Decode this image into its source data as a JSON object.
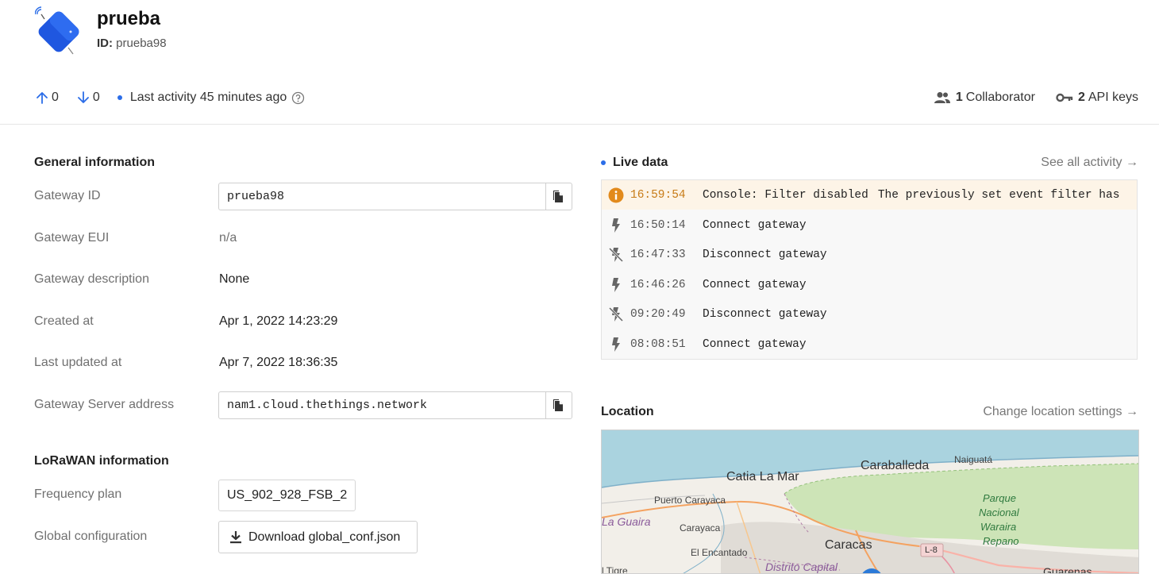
{
  "gateway": {
    "name": "prueba",
    "id_label": "ID:",
    "id_value": "prueba98"
  },
  "stats": {
    "uplink_count": "0",
    "downlink_count": "0",
    "last_activity": "Last activity 45 minutes ago",
    "collaborators_count": "1",
    "collaborators_label": "Collaborator",
    "api_keys_count": "2",
    "api_keys_label": "API keys"
  },
  "general": {
    "title": "General information",
    "gateway_id_label": "Gateway ID",
    "gateway_id_value": "prueba98",
    "gateway_eui_label": "Gateway EUI",
    "gateway_eui_value": "n/a",
    "description_label": "Gateway description",
    "description_value": "None",
    "created_label": "Created at",
    "created_value": "Apr 1, 2022 14:23:29",
    "updated_label": "Last updated at",
    "updated_value": "Apr 7, 2022 18:36:35",
    "server_label": "Gateway Server address",
    "server_value": "nam1.cloud.thethings.network"
  },
  "lorawan": {
    "title": "LoRaWAN information",
    "freq_label": "Frequency plan",
    "freq_value": "US_902_928_FSB_2",
    "global_conf_label": "Global configuration",
    "download_label": "Download global_conf.json"
  },
  "live": {
    "title": "Live data",
    "see_all": "See all activity →",
    "events": [
      {
        "type": "warn",
        "icon": "info-icon",
        "time": "16:59:54",
        "msg": "Console: Filter disabled",
        "detail": "The previously set event filter has"
      },
      {
        "type": "connect",
        "icon": "bolt-icon",
        "time": "16:50:14",
        "msg": "Connect gateway",
        "detail": ""
      },
      {
        "type": "disconnect",
        "icon": "bolt-off-icon",
        "time": "16:47:33",
        "msg": "Disconnect gateway",
        "detail": ""
      },
      {
        "type": "connect",
        "icon": "bolt-icon",
        "time": "16:46:26",
        "msg": "Connect gateway",
        "detail": ""
      },
      {
        "type": "disconnect",
        "icon": "bolt-off-icon",
        "time": "09:20:49",
        "msg": "Disconnect gateway",
        "detail": ""
      },
      {
        "type": "connect",
        "icon": "bolt-icon",
        "time": "08:08:51",
        "msg": "Connect gateway",
        "detail": ""
      }
    ]
  },
  "location": {
    "title": "Location",
    "change_link": "Change location settings →",
    "map_labels": {
      "caraballeda": "Caraballeda",
      "naiguata": "Naiguatá",
      "catia": "Catia La Mar",
      "puerto": "Puerto Carayaca",
      "laguaira": "La Guaira",
      "carayaca": "Carayaca",
      "parque": "Parque",
      "nacional": "Nacional",
      "waraira": "Waraira",
      "repano": "Repano",
      "caracas": "Caracas",
      "l8": "L-8",
      "encantado": "El Encantado",
      "distrito": "Distrito Capital",
      "tigre": "l Tigre",
      "guarenas": "Guarenas"
    }
  },
  "colors": {
    "accent": "#2b6de8",
    "warn": "#e28a1c",
    "map_water": "#aad3df",
    "map_land": "#f2efe9",
    "map_park": "#cde4b7"
  }
}
